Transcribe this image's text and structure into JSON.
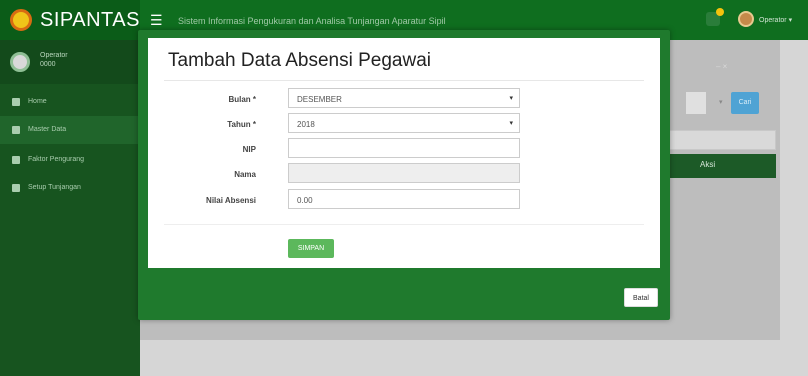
{
  "app": {
    "brand": "SIPANTAS",
    "subtitle": "Sistem Informasi Pengukuran dan Analisa Tunjangan Aparatur Sipil",
    "user_menu": "Operator ▾"
  },
  "sidebar": {
    "user_name": "Operator",
    "user_code": "0000",
    "items": [
      {
        "label": "Home",
        "icon": "home-icon"
      },
      {
        "label": "Master Data",
        "icon": "users-icon"
      },
      {
        "label": "Faktor Pengurang",
        "icon": "file-icon"
      },
      {
        "label": "Setup Tunjangan",
        "icon": "file-icon"
      }
    ]
  },
  "background": {
    "search_button": "Cari",
    "table_action_header": "Aksi"
  },
  "modal": {
    "title": "Tambah Data Absensi Pegawai",
    "fields": {
      "bulan": {
        "label": "Bulan *",
        "value": "DESEMBER"
      },
      "tahun": {
        "label": "Tahun *",
        "value": "2018"
      },
      "nip": {
        "label": "NIP",
        "value": ""
      },
      "nama": {
        "label": "Nama",
        "value": ""
      },
      "nilai": {
        "label": "Nilai Absensi",
        "value": "0.00"
      }
    },
    "save_button": "SIMPAN",
    "cancel_button": "Batal"
  },
  "colors": {
    "header_green": "#0f6e1f",
    "sidebar_green": "#17541f",
    "modal_frame": "#1f7a2d",
    "save_button": "#5cb85c"
  }
}
